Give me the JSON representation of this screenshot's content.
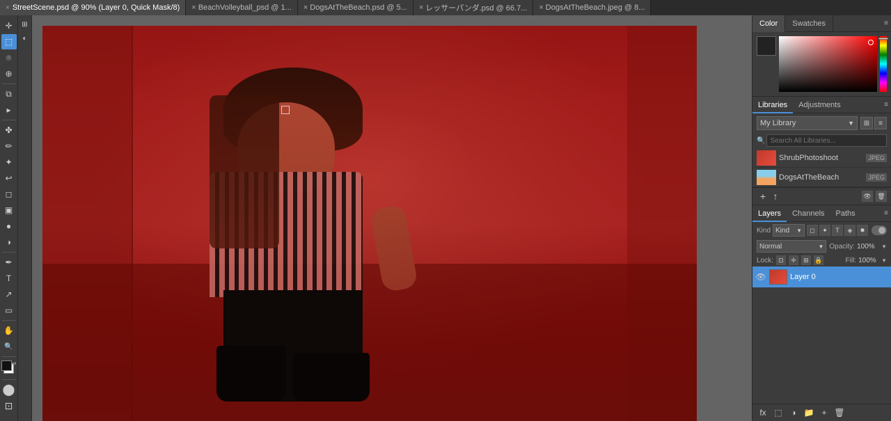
{
  "tabbar": {
    "tabs": [
      {
        "id": "tab1",
        "name": "StreetScene.psd @ 90% (Layer 0, Quick Mask/8)",
        "active": true,
        "modified": true
      },
      {
        "id": "tab2",
        "name": "BeachVolleyball_psd @ 1...",
        "active": false,
        "modified": false
      },
      {
        "id": "tab3",
        "name": "DogsAtTheBeach.psd @ 5...",
        "active": false,
        "modified": false
      },
      {
        "id": "tab4",
        "name": "レッサーパンダ.psd @ 66.7...",
        "active": false,
        "modified": false
      },
      {
        "id": "tab5",
        "name": "DogsAtTheBeach.jpeg @ 8...",
        "active": false,
        "modified": false
      }
    ]
  },
  "toolbar": {
    "tools": [
      {
        "name": "move",
        "icon": "✛"
      },
      {
        "name": "rectangular-marquee",
        "icon": "⬚"
      },
      {
        "name": "lasso",
        "icon": "⌾"
      },
      {
        "name": "quick-select",
        "icon": "⊕"
      },
      {
        "name": "crop",
        "icon": "⧉"
      },
      {
        "name": "eyedropper",
        "icon": "⋮"
      },
      {
        "name": "spot-heal",
        "icon": "✤"
      },
      {
        "name": "brush",
        "icon": "✏"
      },
      {
        "name": "clone-stamp",
        "icon": "✦"
      },
      {
        "name": "history-brush",
        "icon": "↩"
      },
      {
        "name": "eraser",
        "icon": "◻"
      },
      {
        "name": "gradient",
        "icon": "▣"
      },
      {
        "name": "blur",
        "icon": "●"
      },
      {
        "name": "dodge",
        "icon": "◑"
      },
      {
        "name": "pen",
        "icon": "✒"
      },
      {
        "name": "text",
        "icon": "T"
      },
      {
        "name": "path-select",
        "icon": "↗"
      },
      {
        "name": "shape",
        "icon": "▭"
      },
      {
        "name": "hand",
        "icon": "✋"
      },
      {
        "name": "zoom",
        "icon": "🔍"
      },
      {
        "name": "more",
        "icon": "…"
      },
      {
        "name": "artboard",
        "icon": "⊞"
      }
    ]
  },
  "color_panel": {
    "tab_color": "Color",
    "tab_swatches": "Swatches",
    "active_tab": "Color"
  },
  "libraries": {
    "tab_libraries": "Libraries",
    "tab_adjustments": "Adjustments",
    "active_tab": "Libraries",
    "dropdown_label": "My Library",
    "search_placeholder": "Search All Libraries...",
    "items": [
      {
        "name": "ShrubPhotoshoot",
        "type": "JPEG",
        "thumb_color": "red"
      },
      {
        "name": "DogsAtTheBeach",
        "type": "JPEG",
        "thumb_color": "beach"
      }
    ],
    "add_btn": "+",
    "upload_btn": "↑"
  },
  "layers": {
    "tab_layers": "Layers",
    "tab_channels": "Channels",
    "tab_paths": "Paths",
    "active_tab": "Layers",
    "filter_label": "Kind",
    "blend_mode": "Normal",
    "opacity_label": "Opacity:",
    "opacity_value": "100%",
    "lock_label": "Lock:",
    "fill_label": "Fill:",
    "fill_value": "100%",
    "items": [
      {
        "name": "Layer 0",
        "visible": true
      }
    ],
    "filter_icons": [
      "◻",
      "✦",
      "T",
      "◈",
      "✸"
    ]
  }
}
